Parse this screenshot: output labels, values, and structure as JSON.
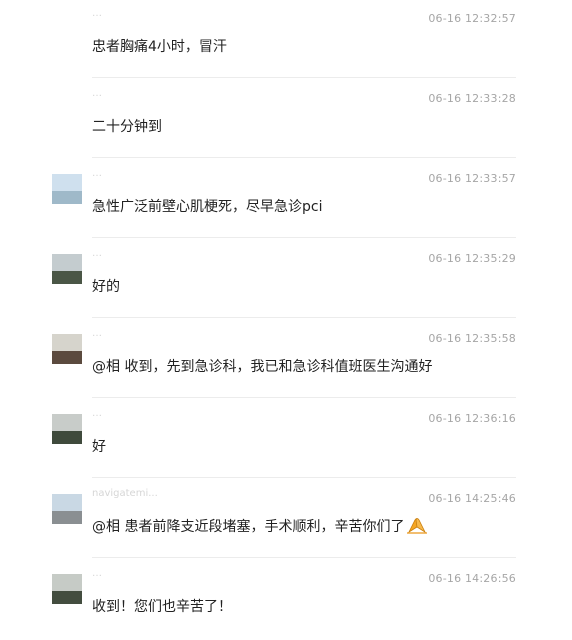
{
  "messages": [
    {
      "sender": "…",
      "time": "06-16 12:32:57",
      "text": "忠者胸痛4小时，冒汗",
      "avatar": "none"
    },
    {
      "sender": "…",
      "time": "06-16 12:33:28",
      "text": "二十分钟到",
      "avatar": "none"
    },
    {
      "sender": "…",
      "time": "06-16 12:33:57",
      "text": "急性广泛前壁心肌梗死，尽早急诊pci",
      "avatar": "blue-scene"
    },
    {
      "sender": "…",
      "time": "06-16 12:35:29",
      "text": "好的",
      "avatar": "landscape"
    },
    {
      "sender": "…",
      "time": "06-16 12:35:58",
      "text": "@相 收到，先到急诊科，我已和急诊科值班医生沟通好",
      "avatar": "road"
    },
    {
      "sender": "…",
      "time": "06-16 12:36:16",
      "text": "好",
      "avatar": "landscape"
    },
    {
      "sender": "navigatemi...",
      "time": "06-16 14:25:46",
      "text": "@相 患者前降支近段堵塞，手术顺利，辛苦你们了",
      "avatar": "sky-car",
      "emoji": "praying-hands-icon"
    },
    {
      "sender": "…",
      "time": "06-16 14:26:56",
      "text": "收到！您们也辛苦了！",
      "avatar": "landscape"
    }
  ],
  "colors": {
    "text": "#222222",
    "time": "#a6a6a6",
    "divider": "#ececec",
    "emoji": "#f5a623"
  }
}
